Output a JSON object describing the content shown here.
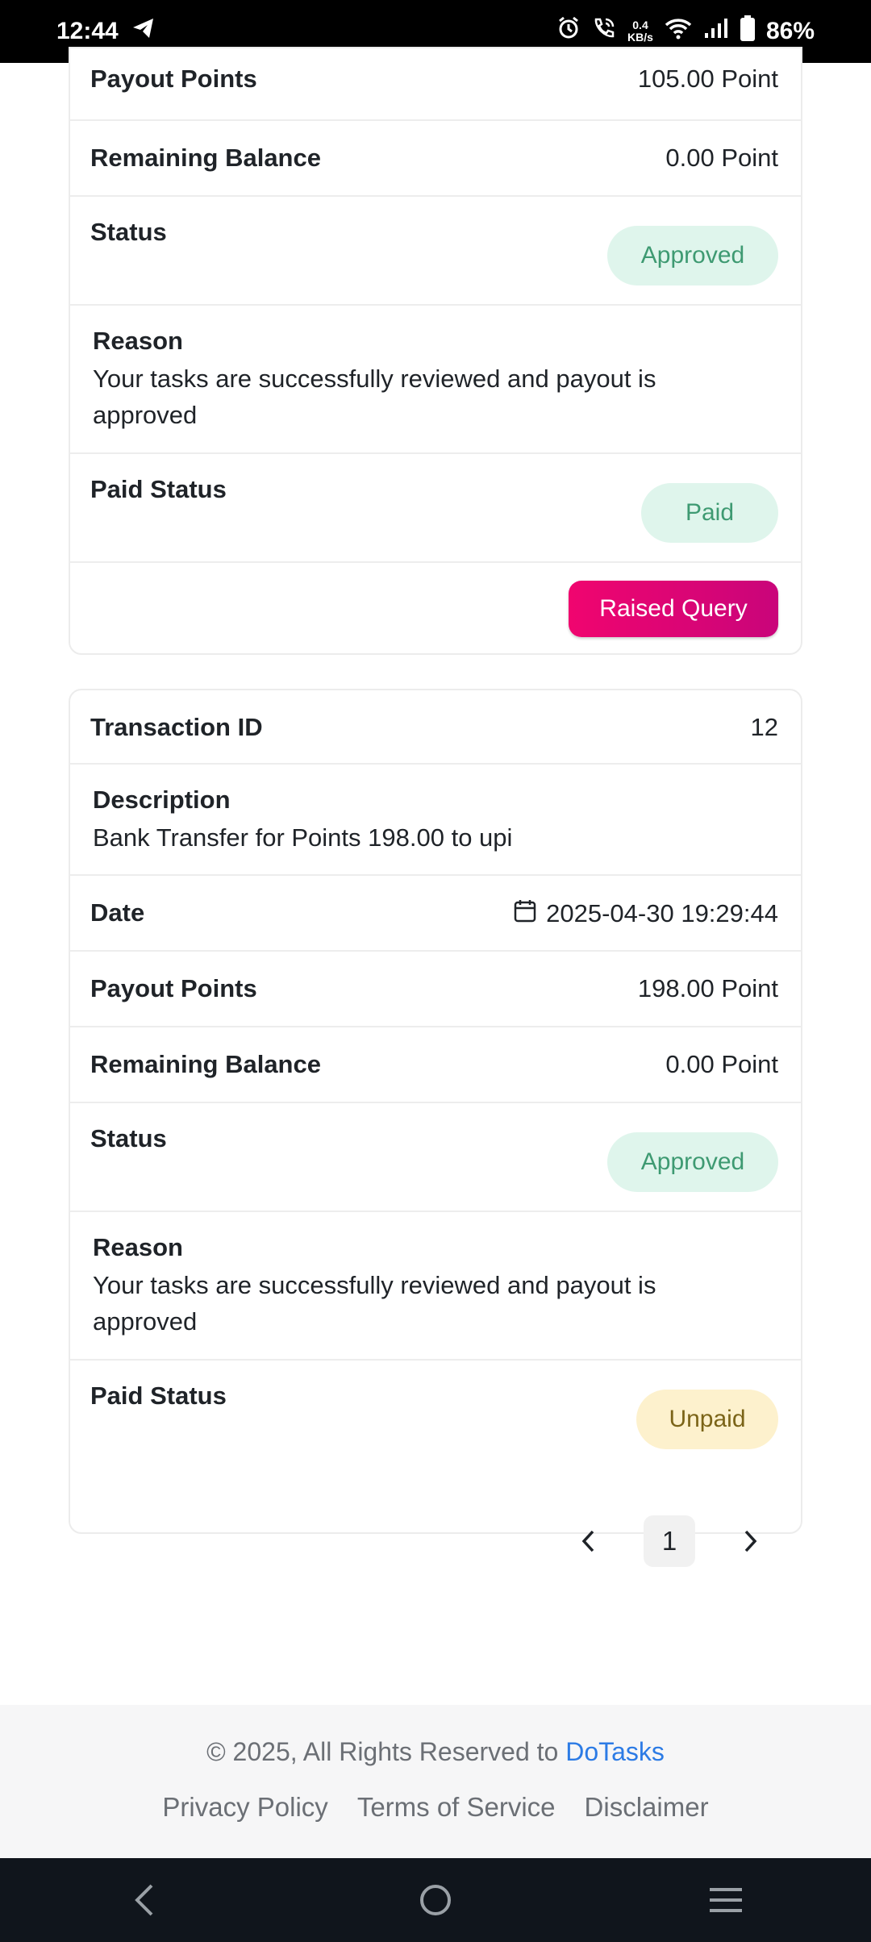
{
  "status_bar": {
    "time": "12:44",
    "net_speed_value": "0.4",
    "net_speed_unit": "KB/s",
    "battery": "86%"
  },
  "transactions": [
    {
      "payout_points_label": "Payout Points",
      "payout_points": "105.00 Point",
      "remaining_balance_label": "Remaining Balance",
      "remaining_balance": "0.00 Point",
      "status_label": "Status",
      "status": "Approved",
      "reason_label": "Reason",
      "reason": "Your tasks are successfully reviewed and payout is approved",
      "paid_status_label": "Paid Status",
      "paid_status": "Paid",
      "query_button": "Raised Query"
    },
    {
      "transaction_id_label": "Transaction ID",
      "transaction_id": "12",
      "description_label": "Description",
      "description": "Bank Transfer for Points 198.00 to upi",
      "date_label": "Date",
      "date": "2025-04-30 19:29:44",
      "payout_points_label": "Payout Points",
      "payout_points": "198.00 Point",
      "remaining_balance_label": "Remaining Balance",
      "remaining_balance": "0.00 Point",
      "status_label": "Status",
      "status": "Approved",
      "reason_label": "Reason",
      "reason": "Your tasks are successfully reviewed and payout is approved",
      "paid_status_label": "Paid Status",
      "paid_status": "Unpaid"
    }
  ],
  "pagination": {
    "current_page": "1"
  },
  "footer": {
    "copyright_prefix": "© 2025, All Rights Reserved to ",
    "brand": "DoTasks",
    "links": [
      "Privacy Policy",
      "Terms of Service",
      "Disclaimer"
    ]
  },
  "colors": {
    "approved_bg": "#dff5ec",
    "approved_text": "#3e9a72",
    "unpaid_bg": "#fdf1cd",
    "unpaid_text": "#7b6418",
    "query_button": "#e6056f",
    "brand_link": "#2c7be5"
  },
  "icons": [
    "telegram-icon",
    "alarm-icon",
    "wifi-call-icon",
    "wifi-icon",
    "signal-icon",
    "battery-icon",
    "calendar-icon",
    "chevron-left-icon",
    "chevron-right-icon",
    "back-icon",
    "home-icon",
    "menu-icon"
  ]
}
